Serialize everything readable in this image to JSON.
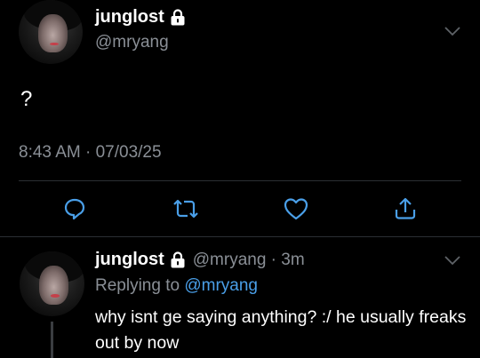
{
  "tweet": {
    "display_name": "junglost",
    "handle": "@mryang",
    "text": "?",
    "timestamp": "8:43 AM · 07/03/25",
    "locked": true
  },
  "actions": {
    "reply": "reply-icon",
    "retweet": "retweet-icon",
    "like": "heart-icon",
    "share": "share-icon"
  },
  "reply": {
    "display_name": "junglost",
    "handle_time": "@mryang · 3m",
    "replying_prefix": "Replying to",
    "replying_mention": "@mryang",
    "text": "why isnt ge saying anything? :/ he usually freaks out by now",
    "locked": true
  },
  "colors": {
    "background": "#000000",
    "text": "#ffffff",
    "secondary": "#8a8f96",
    "mention": "#4a9fe8",
    "divider": "#2b2f33"
  }
}
